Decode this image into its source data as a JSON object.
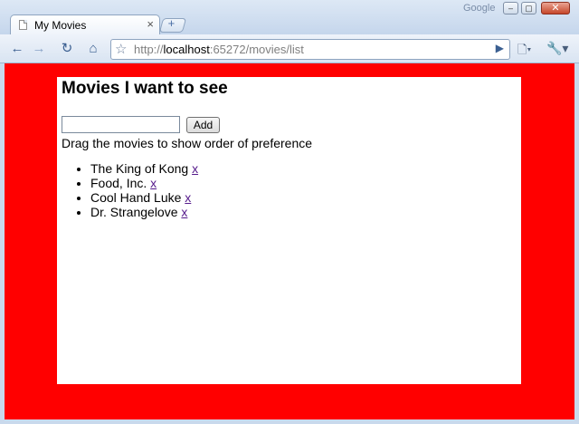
{
  "window": {
    "tab_title": "My Movies",
    "tab_close": "×",
    "new_tab": "+",
    "brand": "Google",
    "minimize": "–",
    "maximize": "▢",
    "close": "✕"
  },
  "toolbar": {
    "back": "←",
    "forward": "→",
    "reload": "↻",
    "home": "⌂",
    "star": "☆",
    "url_prefix": "http://",
    "url_host": "localhost",
    "url_rest": ":65272/movies/list",
    "go": "▶",
    "page_menu": "🗋▾",
    "tools_menu": "🔧▾"
  },
  "colors": {
    "page_background": "#ff0000",
    "panel_background": "#ffffff",
    "link": "#551a8b"
  },
  "page": {
    "heading": "Movies I want to see",
    "input_value": "",
    "add_label": "Add",
    "instruction": "Drag the movies to show order of preference",
    "movies": [
      {
        "title": "The King of Kong",
        "remove": "x"
      },
      {
        "title": "Food, Inc.",
        "remove": "x"
      },
      {
        "title": "Cool Hand Luke",
        "remove": "x"
      },
      {
        "title": "Dr. Strangelove",
        "remove": "x"
      }
    ]
  }
}
